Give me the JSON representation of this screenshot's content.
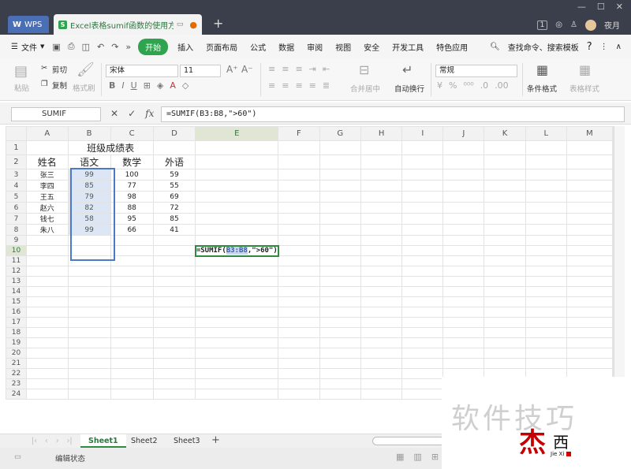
{
  "app": {
    "wps_label": "WPS",
    "doc_tab_title": "Excel表格sumif函数的使用方法",
    "new_tab": "+",
    "page_badge": "1",
    "user_name": "夜月"
  },
  "menu": {
    "file_label": "文件",
    "tabs": [
      "开始",
      "插入",
      "页面布局",
      "公式",
      "数据",
      "审阅",
      "视图",
      "安全",
      "开发工具",
      "特色应用"
    ],
    "active_tab": "开始",
    "search_label": "查找命令、搜索模板",
    "help": "?"
  },
  "ribbon": {
    "paste": "粘贴",
    "cut": "剪切",
    "copy": "复制",
    "format_painter": "格式刷",
    "font_name": "宋体",
    "font_size": "11",
    "merge_center": "合并居中",
    "wrap_text": "自动换行",
    "number_format": "常规",
    "conditional_format": "条件格式",
    "table_style": "表格样式"
  },
  "formula_bar": {
    "name_box": "SUMIF",
    "fx": "fx",
    "formula": "=SUMIF(B3:B8,\">60\")"
  },
  "grid": {
    "columns": [
      "A",
      "B",
      "C",
      "D",
      "E",
      "F",
      "G",
      "H",
      "I",
      "J",
      "K",
      "L",
      "M"
    ],
    "active_column": "E",
    "active_row": "10",
    "title": "班级成绩表",
    "headers": [
      "姓名",
      "语文",
      "数学",
      "外语"
    ],
    "rows": [
      [
        "张三",
        "99",
        "100",
        "59"
      ],
      [
        "李四",
        "85",
        "77",
        "55"
      ],
      [
        "王五",
        "79",
        "98",
        "69"
      ],
      [
        "赵六",
        "82",
        "88",
        "72"
      ],
      [
        "钱七",
        "58",
        "95",
        "85"
      ],
      [
        "朱八",
        "99",
        "66",
        "41"
      ]
    ],
    "row_numbers": [
      "1",
      "2",
      "3",
      "4",
      "5",
      "6",
      "7",
      "8",
      "9",
      "10",
      "11",
      "12",
      "13",
      "14",
      "15",
      "16",
      "17",
      "18",
      "19",
      "20",
      "21",
      "22",
      "23",
      "24"
    ],
    "edit_prefix": "=SUMIF(",
    "edit_range": "B3:B8",
    "edit_suffix": ",\">60\")"
  },
  "sheets": {
    "tabs": [
      "Sheet1",
      "Sheet2",
      "Sheet3"
    ],
    "active": "Sheet1",
    "add": "+"
  },
  "status": {
    "mode": "编辑状态"
  },
  "watermark": {
    "text": "软件技巧",
    "logo_char1": "杰",
    "logo_char2": "西",
    "logo_pinyin": "Jie Xi"
  }
}
